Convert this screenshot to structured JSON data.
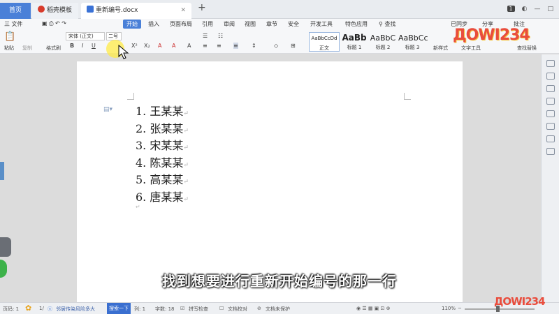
{
  "tabs": {
    "home": "首页",
    "template": "稻壳模板",
    "document": "重新编号.docx",
    "new": "+"
  },
  "window": {
    "badge": "1"
  },
  "menu": {
    "file": "三 文件",
    "start": "开始",
    "items": [
      "插入",
      "页面布局",
      "引用",
      "审阅",
      "视图",
      "章节",
      "安全",
      "开发工具",
      "特色应用"
    ],
    "search": "查找",
    "right": [
      "已同步",
      "分享",
      "批注"
    ]
  },
  "ribbon": {
    "paste": "粘贴",
    "copy": "复制",
    "format_painter": "格式刷",
    "font": "宋体 (正文)",
    "size": "二号",
    "styles": [
      {
        "preview": "AaBbCcDd",
        "label": "正文"
      },
      {
        "preview": "AaBb",
        "label": "标题 1"
      },
      {
        "preview": "AaBbC",
        "label": "标题 2"
      },
      {
        "preview": "AaBbCc",
        "label": "标题 3"
      }
    ],
    "new_style": "新样式",
    "text_tools": "文字工具",
    "find_replace": "查找替换"
  },
  "document": {
    "items": [
      "1. 王某某",
      "2. 张某某",
      "3. 宋某某",
      "4. 陈某某",
      "5. 高某某",
      "6. 唐某某"
    ]
  },
  "subtitle": "找到想要进行重新开始编号的那一行",
  "status": {
    "page": "页码: 1",
    "pagecount": "1/",
    "news": "邻居传染风险多大",
    "search": "搜索一下",
    "column": "列: 1",
    "words": "字数: 18",
    "spell": "拼写检查",
    "proof": "文档校对",
    "protect": "文档未保护",
    "zoom": "110%"
  },
  "logo": "ДOWI234",
  "colors": {
    "accent": "#4a80d8",
    "highlight": "#ffeb46",
    "logo": "#e94d3d"
  }
}
